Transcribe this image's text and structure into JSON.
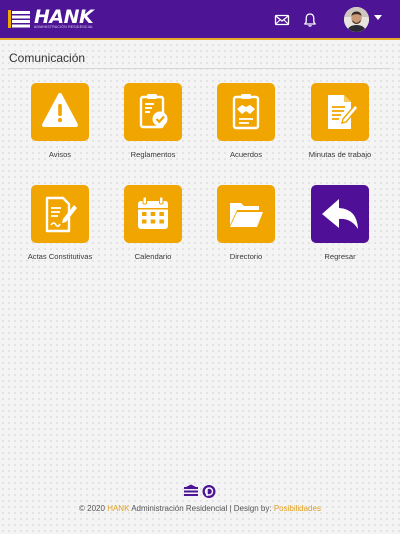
{
  "brand": {
    "name": "HANK",
    "subtitle": "ADMINISTRACIÓN RESIDENCIAL",
    "primary_color": "#4d1495",
    "accent_color": "#f0a500"
  },
  "header": {
    "icons": [
      "mail-icon",
      "bell-icon",
      "user-avatar",
      "chevron-down-icon"
    ]
  },
  "page": {
    "title": "Comunicación"
  },
  "tiles": [
    {
      "label": "Avisos",
      "icon": "warning-icon"
    },
    {
      "label": "Reglamentos",
      "icon": "checklist-icon"
    },
    {
      "label": "Acuerdos",
      "icon": "handshake-clipboard-icon"
    },
    {
      "label": "Minutas de trabajo",
      "icon": "document-edit-icon"
    },
    {
      "label": "Actas Constitutivas",
      "icon": "document-sign-icon"
    },
    {
      "label": "Calendario",
      "icon": "calendar-icon"
    },
    {
      "label": "Directorio",
      "icon": "folder-icon"
    },
    {
      "label": "Regresar",
      "icon": "back-arrow-icon"
    }
  ],
  "footer": {
    "copyright": "© 2020",
    "brand": "HANK",
    "text": "Administración Residencial | Design by:",
    "designer": "Posibilidades"
  }
}
